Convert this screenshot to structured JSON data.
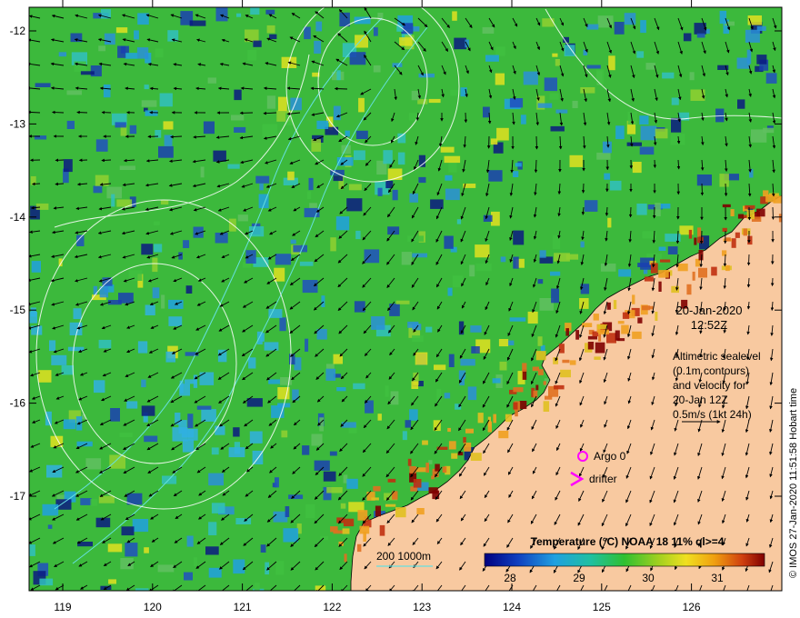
{
  "map": {
    "lat_ticks": [
      "-12",
      "-13",
      "-14",
      "-15",
      "-16",
      "-17"
    ],
    "lon_ticks": [
      "119",
      "120",
      "121",
      "122",
      "123",
      "124",
      "125",
      "126"
    ]
  },
  "annotations": {
    "date": "20-Jan-2020",
    "time": "12:52Z",
    "altimetry_lines": [
      "Altimetric sealevel",
      "(0.1m contours)",
      "and velocity for",
      "20-Jan 12Z",
      "0.5m/s (1kt 24h)"
    ],
    "argo_label": "Argo 0",
    "drifter_label": "drifter",
    "depth_label": "200  1000m"
  },
  "colorbar": {
    "title": "Temperature (°C) NOAA 18 11% ql>=4",
    "ticks": [
      "28",
      "29",
      "30",
      "31"
    ]
  },
  "credit": "© IMOS 27-Jan-2020 11:51:58 Hobart time",
  "colors": {
    "land": "#f8c9a0",
    "marker_magenta": "#ff00ff",
    "isobath_cyan": "#66e0e0"
  }
}
